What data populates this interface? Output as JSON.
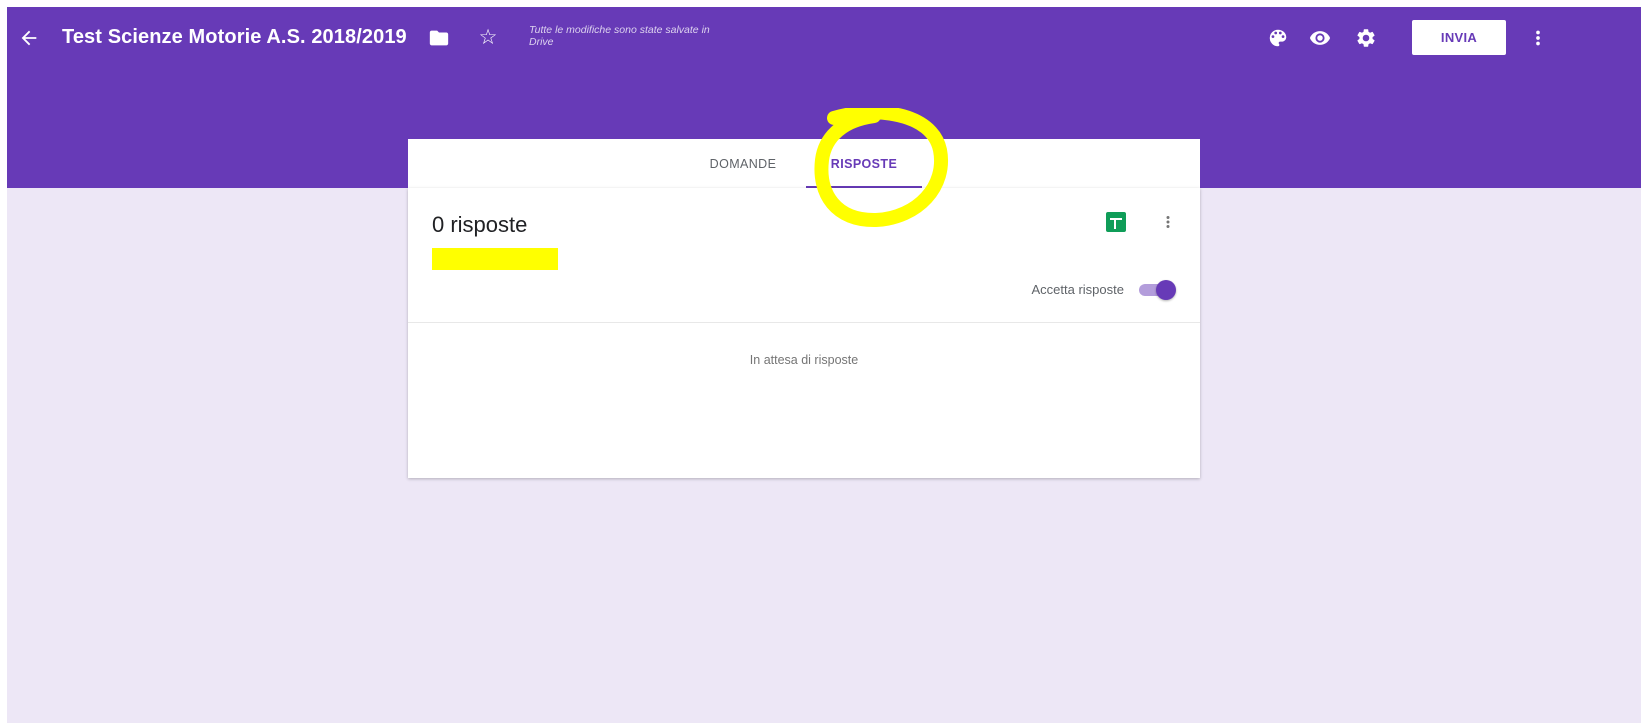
{
  "header": {
    "title": "Test Scienze Motorie A.S. 2018/2019",
    "save_status": "Tutte le modifiche sono state salvate in Drive",
    "send_label": "INVIA",
    "icons": [
      "arrow-back-icon",
      "folder-icon",
      "star-outline-icon",
      "palette-icon",
      "eye-icon",
      "gear-icon",
      "more-vert-icon"
    ],
    "star_glyph": "☆"
  },
  "tabs": [
    {
      "label": "DOMANDE",
      "active": false
    },
    {
      "label": "RISPOSTE",
      "active": true
    }
  ],
  "responses": {
    "count_label": "0 risposte",
    "accept_label": "Accetta risposte",
    "accepting": true,
    "empty_message": "In attesa di risposte",
    "icons": [
      "sheets-icon",
      "more-vert-icon"
    ]
  },
  "colors": {
    "brand": "#673ab7",
    "background": "#ede7f6",
    "sheets_green": "#0f9d58",
    "annotation_yellow": "#ffff00"
  }
}
